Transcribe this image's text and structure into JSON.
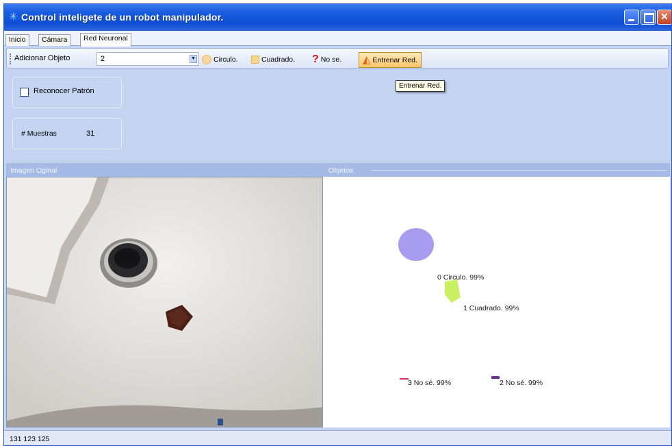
{
  "window": {
    "title": "Control inteligete de un robot manipulador.",
    "colors": {
      "titlebar": "#1a5de0",
      "panel": "#c4d3f0",
      "close": "#c4431e"
    }
  },
  "tabs": [
    {
      "label": "Inicio",
      "active": false
    },
    {
      "label": "Cámara",
      "active": false
    },
    {
      "label": "Red Neuronal",
      "active": true
    }
  ],
  "toolbar": {
    "add_object_label": "Adicionar Objeto",
    "combo_value": "2",
    "circle_label": "Circulo.",
    "square_label": "Cuadrado.",
    "unknown_label": "No se.",
    "train_label": "Entrenar Red.",
    "tooltip": "Entrenar Red."
  },
  "controls": {
    "recognize_label": "Reconocer Patrón",
    "recognize_checked": false,
    "samples_label": "# Muestras",
    "samples_value": "31"
  },
  "panels": {
    "original_title": "Imagen Oginal",
    "objects_title": "Objetos"
  },
  "objects": [
    {
      "label": "0 Circulo. 99%",
      "shape": "circle",
      "color": "#a89cf0"
    },
    {
      "label": "1 Cuadrado. 99%",
      "shape": "square",
      "color": "#c8f060"
    },
    {
      "label": "3 No sé. 99%",
      "shape": "line",
      "color": "#e03060"
    },
    {
      "label": "2 No sé. 99%",
      "shape": "line",
      "color": "#7030a0"
    }
  ],
  "status": {
    "text": "131 123 125"
  }
}
